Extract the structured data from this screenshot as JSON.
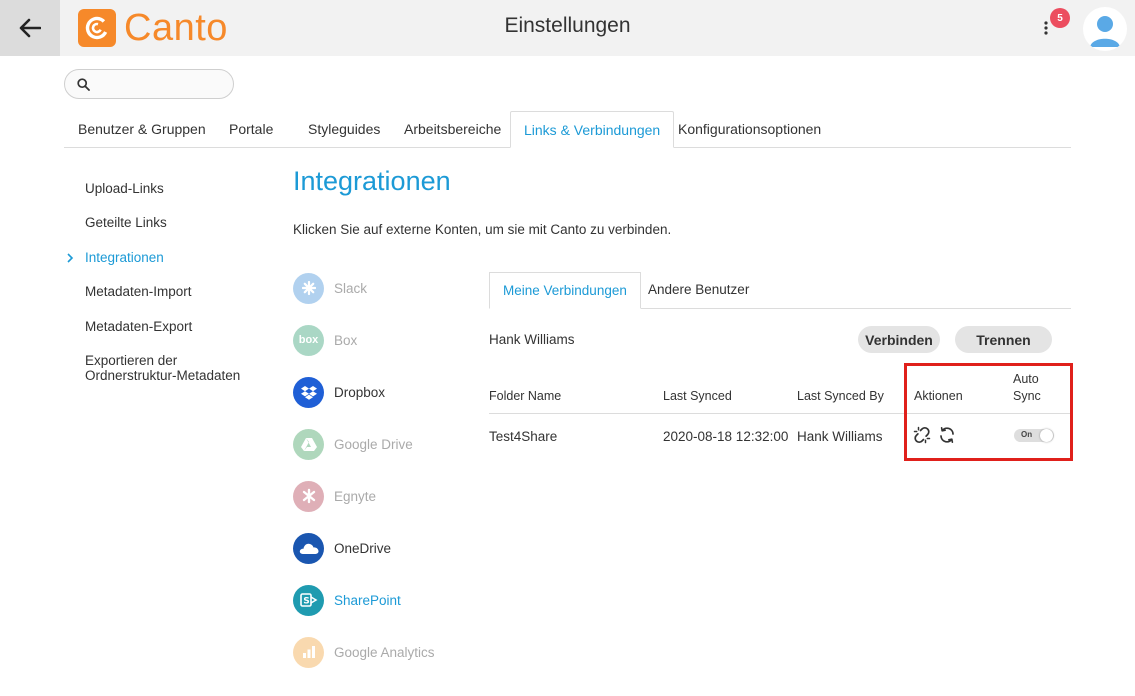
{
  "header": {
    "brand": "Canto",
    "title": "Einstellungen",
    "notification_count": "5"
  },
  "search": {
    "placeholder": "",
    "value": ""
  },
  "top_tabs": [
    {
      "label": "Benutzer & Gruppen"
    },
    {
      "label": "Portale"
    },
    {
      "label": "Styleguides"
    },
    {
      "label": "Arbeitsbereiche"
    },
    {
      "label": "Links & Verbindungen",
      "active": true
    },
    {
      "label": "Konfigurationsoptionen"
    }
  ],
  "sidebar": {
    "items": [
      {
        "label": "Upload-Links"
      },
      {
        "label": "Geteilte Links"
      },
      {
        "label": "Integrationen",
        "active": true
      },
      {
        "label": "Metadaten-Import"
      },
      {
        "label": "Metadaten-Export"
      },
      {
        "label": "Exportieren der Ordnerstruktur-Metadaten"
      }
    ]
  },
  "main": {
    "title": "Integrationen",
    "description": "Klicken Sie auf externe Konten, um sie mit Canto zu verbinden."
  },
  "services": [
    {
      "label": "Slack",
      "color": "#3f8fd8",
      "icon": "slack-icon",
      "enabled": false
    },
    {
      "label": "Box",
      "color": "#2d9e6f",
      "icon": "box-icon",
      "icon_text": "box",
      "enabled": false
    },
    {
      "label": "Dropbox",
      "color": "#1f5fd6",
      "icon": "dropbox-icon",
      "enabled": true
    },
    {
      "label": "Google Drive",
      "color": "#3a9e5a",
      "icon": "google-drive-icon",
      "enabled": false
    },
    {
      "label": "Egnyte",
      "color": "#b03a4e",
      "icon": "egnyte-icon",
      "enabled": false
    },
    {
      "label": "OneDrive",
      "color": "#1a56b0",
      "icon": "onedrive-icon",
      "enabled": true
    },
    {
      "label": "SharePoint",
      "color": "#1f9bb0",
      "icon": "sharepoint-icon",
      "enabled": true,
      "active": true
    },
    {
      "label": "Google Analytics",
      "color": "#f2a33a",
      "icon": "google-analytics-icon",
      "enabled": false
    }
  ],
  "inner_tabs": [
    {
      "label": "Meine Verbindungen",
      "active": true
    },
    {
      "label": "Andere Benutzer"
    }
  ],
  "account": {
    "name": "Hank Williams"
  },
  "buttons": {
    "connect": "Verbinden",
    "disconnect": "Trennen"
  },
  "table": {
    "headers": {
      "folder_name": "Folder Name",
      "last_synced": "Last Synced",
      "last_synced_by": "Last Synced By",
      "actions": "Aktionen",
      "auto_sync": "Auto Sync"
    },
    "rows": [
      {
        "folder_name": "Test4Share",
        "last_synced": "2020-08-18 12:32:00",
        "last_synced_by": "Hank Williams",
        "auto_sync": "On"
      }
    ]
  },
  "colors": {
    "accent": "#1c9ad6",
    "brand": "#f6892a",
    "highlight": "#e0201b",
    "badge": "#ec4d5f"
  }
}
